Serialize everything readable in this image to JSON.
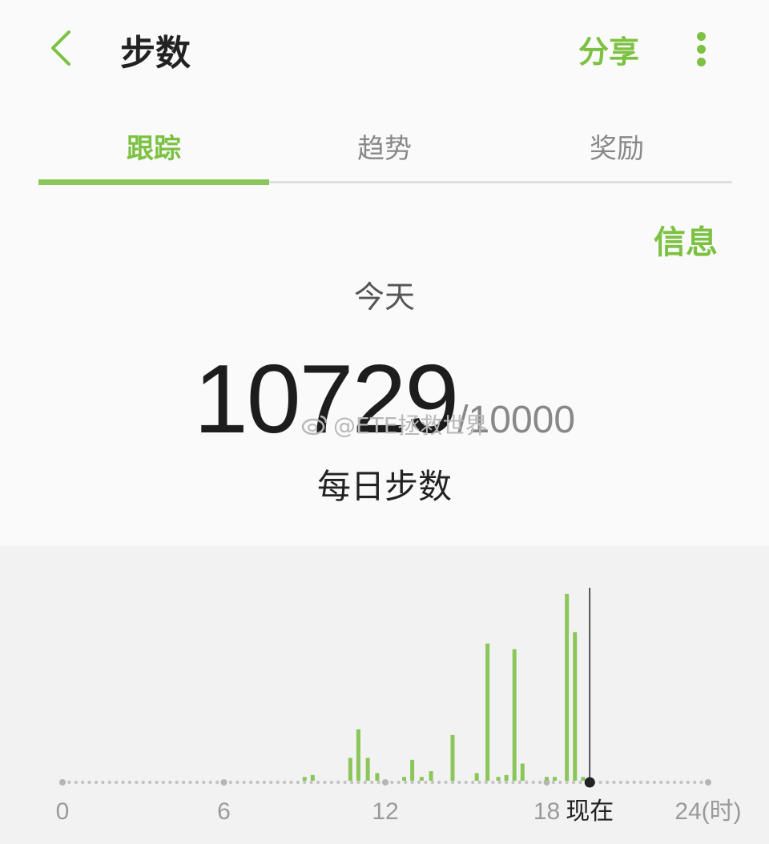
{
  "header": {
    "title": "步数",
    "share_label": "分享"
  },
  "tabs": [
    {
      "label": "跟踪",
      "active": true
    },
    {
      "label": "趋势",
      "active": false
    },
    {
      "label": "奖励",
      "active": false
    }
  ],
  "info_label": "信息",
  "today_label": "今天",
  "steps": {
    "count": "10729",
    "goal": "/10000",
    "caption": "每日步数"
  },
  "watermark": "@ETE拯救世界",
  "colors": {
    "accent": "#7cc142",
    "bar": "#8ac65a",
    "text_dark": "#222222",
    "text_muted": "#888888"
  },
  "chart_data": {
    "type": "bar",
    "x_unit": "hour",
    "xlim": [
      0,
      24
    ],
    "x_tick_labels": [
      "0",
      "6",
      "12",
      "18",
      "24(时)"
    ],
    "now_label": "现在",
    "now_hour": 19.6,
    "bins": [
      {
        "x": 9.0,
        "v": 0.02
      },
      {
        "x": 9.3,
        "v": 0.03
      },
      {
        "x": 10.7,
        "v": 0.12
      },
      {
        "x": 11.0,
        "v": 0.27
      },
      {
        "x": 11.35,
        "v": 0.12
      },
      {
        "x": 11.7,
        "v": 0.04
      },
      {
        "x": 12.7,
        "v": 0.02
      },
      {
        "x": 13.0,
        "v": 0.11
      },
      {
        "x": 13.35,
        "v": 0.02
      },
      {
        "x": 13.7,
        "v": 0.05
      },
      {
        "x": 14.5,
        "v": 0.24
      },
      {
        "x": 15.4,
        "v": 0.04
      },
      {
        "x": 15.8,
        "v": 0.72
      },
      {
        "x": 16.2,
        "v": 0.02
      },
      {
        "x": 16.5,
        "v": 0.03
      },
      {
        "x": 16.8,
        "v": 0.69
      },
      {
        "x": 17.1,
        "v": 0.09
      },
      {
        "x": 18.0,
        "v": 0.02
      },
      {
        "x": 18.3,
        "v": 0.02
      },
      {
        "x": 18.75,
        "v": 0.98
      },
      {
        "x": 19.05,
        "v": 0.78
      },
      {
        "x": 19.35,
        "v": 0.02
      }
    ]
  }
}
